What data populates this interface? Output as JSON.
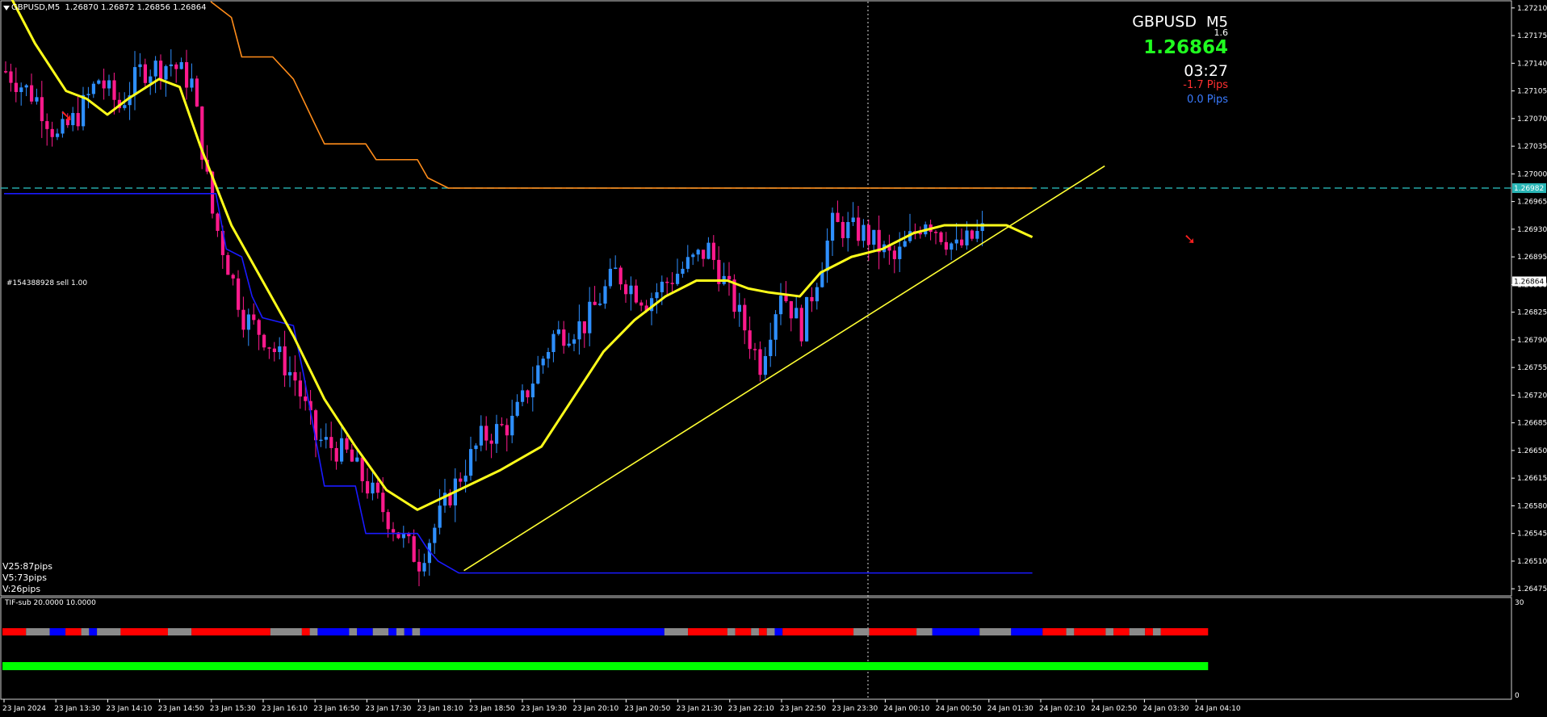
{
  "header": {
    "symbol_tf": "GBPUSD,M5",
    "ohlc": "1.26870 1.26872 1.26856 1.26864"
  },
  "symbol_panel": {
    "name": "GBPUSD",
    "timeframe": "M5",
    "spread": "1.6",
    "bid": "1.26864",
    "timer": "03:27",
    "pips_red": "-1.7 Pips",
    "pips_blue": "0.0 Pips"
  },
  "order_label": "#154388928 sell 1.00",
  "volatility": [
    "V25:87pips",
    "V5:73pips",
    "V:26pips"
  ],
  "subwindow": {
    "title": "TIF-sub 20.0000 10.0000",
    "scale_top": "30",
    "scale_bottom": "0"
  },
  "colors": {
    "bull": "#2e8fff",
    "bear": "#ff1a8c",
    "ma": "#ffff1a",
    "upper_env": "#ff8c1a",
    "lower_env": "#1a1aff",
    "trendline": "#ffff33",
    "price_line": "#29b6b6",
    "strip_red": "#ff0000",
    "strip_blue": "#0000ff",
    "strip_gray": "#8a8a8a",
    "strip_green": "#00ff00"
  },
  "chart_data": {
    "type": "candlestick",
    "symbol": "GBPUSD",
    "timeframe": "M5",
    "price_axis": [
      "1.27210",
      "1.27175",
      "1.27140",
      "1.27105",
      "1.27070",
      "1.27035",
      "1.27000",
      "1.26965",
      "1.26930",
      "1.26895",
      "1.26860",
      "1.26825",
      "1.26790",
      "1.26755",
      "1.26720",
      "1.26685",
      "1.26650",
      "1.26615",
      "1.26580",
      "1.26545",
      "1.26510",
      "1.26475"
    ],
    "price_range": [
      1.26466,
      1.27218
    ],
    "current_price_label": "1.26864",
    "resistance_level_label": "1.26982",
    "resistance_level": 1.26982,
    "time_axis": [
      "23 Jan 2024",
      "23 Jan 13:30",
      "23 Jan 14:10",
      "23 Jan 14:50",
      "23 Jan 15:30",
      "23 Jan 16:10",
      "23 Jan 16:50",
      "23 Jan 17:30",
      "23 Jan 18:10",
      "23 Jan 18:50",
      "23 Jan 19:30",
      "23 Jan 20:10",
      "23 Jan 20:50",
      "23 Jan 21:30",
      "23 Jan 22:10",
      "23 Jan 22:50",
      "23 Jan 23:30",
      "24 Jan 00:10",
      "24 Jan 00:50",
      "24 Jan 01:30",
      "24 Jan 02:10",
      "24 Jan 02:50",
      "24 Jan 03:30",
      "24 Jan 04:10"
    ],
    "close_path": [
      [
        0,
        1.2713
      ],
      [
        6,
        1.27095
      ],
      [
        10,
        1.27045
      ],
      [
        14,
        1.27075
      ],
      [
        18,
        1.2712
      ],
      [
        22,
        1.27085
      ],
      [
        26,
        1.2713
      ],
      [
        32,
        1.2714
      ],
      [
        36,
        1.27115
      ],
      [
        40,
        1.2695
      ],
      [
        46,
        1.2682
      ],
      [
        50,
        1.26795
      ],
      [
        56,
        1.2674
      ],
      [
        60,
        1.26665
      ],
      [
        66,
        1.26645
      ],
      [
        70,
        1.26605
      ],
      [
        76,
        1.26545
      ],
      [
        80,
        1.2651
      ],
      [
        86,
        1.26595
      ],
      [
        92,
        1.26665
      ],
      [
        98,
        1.26685
      ],
      [
        106,
        1.26795
      ],
      [
        112,
        1.2681
      ],
      [
        118,
        1.26875
      ],
      [
        124,
        1.2684
      ],
      [
        130,
        1.26875
      ],
      [
        136,
        1.26905
      ],
      [
        140,
        1.2685
      ],
      [
        146,
        1.2676
      ],
      [
        150,
        1.26855
      ],
      [
        154,
        1.26805
      ],
      [
        160,
        1.26935
      ],
      [
        166,
        1.26925
      ],
      [
        172,
        1.2689
      ],
      [
        178,
        1.26945
      ],
      [
        184,
        1.26905
      ],
      [
        190,
        1.26932
      ],
      [
        194,
        1.26915
      ],
      [
        199,
        1.2686
      ]
    ],
    "ma_path": [
      [
        0,
        1.2724
      ],
      [
        6,
        1.27165
      ],
      [
        12,
        1.27105
      ],
      [
        16,
        1.27095
      ],
      [
        20,
        1.27075
      ],
      [
        24,
        1.27095
      ],
      [
        30,
        1.2712
      ],
      [
        34,
        1.2711
      ],
      [
        38,
        1.27035
      ],
      [
        44,
        1.26935
      ],
      [
        50,
        1.26865
      ],
      [
        56,
        1.26795
      ],
      [
        62,
        1.26715
      ],
      [
        68,
        1.26655
      ],
      [
        74,
        1.266
      ],
      [
        80,
        1.26575
      ],
      [
        88,
        1.266
      ],
      [
        96,
        1.26625
      ],
      [
        104,
        1.26655
      ],
      [
        110,
        1.26715
      ],
      [
        116,
        1.26775
      ],
      [
        122,
        1.26815
      ],
      [
        128,
        1.26845
      ],
      [
        134,
        1.26865
      ],
      [
        140,
        1.26865
      ],
      [
        144,
        1.26855
      ],
      [
        148,
        1.2685
      ],
      [
        154,
        1.26845
      ],
      [
        158,
        1.26875
      ],
      [
        164,
        1.26895
      ],
      [
        170,
        1.26905
      ],
      [
        176,
        1.26925
      ],
      [
        182,
        1.26935
      ],
      [
        188,
        1.26935
      ],
      [
        194,
        1.26935
      ],
      [
        199,
        1.2692
      ]
    ],
    "upper_env_path": [
      [
        40,
        1.27218
      ],
      [
        44,
        1.27198
      ],
      [
        46,
        1.27148
      ],
      [
        52,
        1.27148
      ],
      [
        56,
        1.2712
      ],
      [
        60,
        1.27065
      ],
      [
        62,
        1.27038
      ],
      [
        70,
        1.27038
      ],
      [
        72,
        1.27018
      ],
      [
        80,
        1.27018
      ],
      [
        82,
        1.26995
      ],
      [
        86,
        1.26982
      ],
      [
        199,
        1.26982
      ]
    ],
    "lower_env_path": [
      [
        0,
        1.26975
      ],
      [
        41,
        1.26975
      ],
      [
        43,
        1.26905
      ],
      [
        46,
        1.26895
      ],
      [
        48,
        1.26845
      ],
      [
        50,
        1.26818
      ],
      [
        56,
        1.26808
      ],
      [
        58,
        1.26745
      ],
      [
        62,
        1.26605
      ],
      [
        68,
        1.26605
      ],
      [
        70,
        1.26545
      ],
      [
        80,
        1.26545
      ],
      [
        82,
        1.26525
      ],
      [
        84,
        1.2651
      ],
      [
        88,
        1.26495
      ],
      [
        199,
        1.26495
      ]
    ],
    "trendline": [
      [
        89,
        1.26498
      ],
      [
        213,
        1.2701
      ]
    ],
    "sell_marker_price": 1.26985,
    "subwindow_strip_segments": [
      [
        "red",
        0,
        3
      ],
      [
        "gray",
        3,
        6
      ],
      [
        "blue",
        6,
        8
      ],
      [
        "red",
        8,
        10
      ],
      [
        "gray",
        10,
        11
      ],
      [
        "blue",
        11,
        12
      ],
      [
        "gray",
        12,
        15
      ],
      [
        "red",
        15,
        21
      ],
      [
        "gray",
        21,
        24
      ],
      [
        "red",
        24,
        34
      ],
      [
        "gray",
        34,
        38
      ],
      [
        "red",
        38,
        39
      ],
      [
        "gray",
        39,
        40
      ],
      [
        "blue",
        40,
        44
      ],
      [
        "gray",
        44,
        45
      ],
      [
        "blue",
        45,
        47
      ],
      [
        "gray",
        47,
        49
      ],
      [
        "blue",
        49,
        50
      ],
      [
        "gray",
        50,
        51
      ],
      [
        "blue",
        51,
        52
      ],
      [
        "gray",
        52,
        53
      ],
      [
        "blue",
        53,
        84
      ],
      [
        "gray",
        84,
        87
      ],
      [
        "red",
        87,
        92
      ],
      [
        "gray",
        92,
        93
      ],
      [
        "red",
        93,
        95
      ],
      [
        "gray",
        95,
        96
      ],
      [
        "red",
        96,
        97
      ],
      [
        "gray",
        97,
        98
      ],
      [
        "blue",
        98,
        99
      ],
      [
        "red",
        99,
        108
      ],
      [
        "gray",
        108,
        110
      ],
      [
        "red",
        110,
        116
      ],
      [
        "gray",
        116,
        118
      ],
      [
        "blue",
        118,
        124
      ],
      [
        "gray",
        124,
        128
      ],
      [
        "blue",
        128,
        132
      ],
      [
        "red",
        132,
        135
      ],
      [
        "gray",
        135,
        136
      ],
      [
        "red",
        136,
        140
      ],
      [
        "gray",
        140,
        141
      ],
      [
        "red",
        141,
        143
      ],
      [
        "gray",
        143,
        145
      ],
      [
        "red",
        145,
        146
      ],
      [
        "gray",
        146,
        147
      ],
      [
        "red",
        147,
        153
      ]
    ]
  }
}
